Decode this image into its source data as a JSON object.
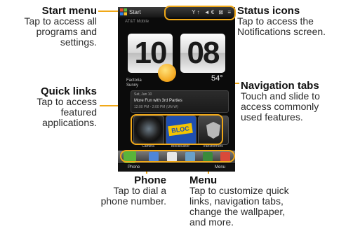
{
  "callouts": {
    "start_menu": {
      "title": "Start menu",
      "desc": [
        "Tap to access all",
        "programs and",
        "settings."
      ]
    },
    "quick_links": {
      "title": "Quick links",
      "desc": [
        "Tap to access",
        "featured",
        "applications."
      ]
    },
    "status_icons": {
      "title": "Status icons",
      "desc": [
        "Tap to access the",
        "Notifications screen."
      ]
    },
    "navigation_tabs": {
      "title": "Navigation tabs",
      "desc": [
        "Touch and slide to",
        "access commonly",
        "used features."
      ]
    },
    "phone": {
      "title": "Phone",
      "desc": [
        "Tap to dial a",
        "phone number."
      ]
    },
    "menu": {
      "title": "Menu",
      "desc": [
        "Tap to customize quick",
        "links, navigation tabs,",
        "change the wallpaper,",
        "and more."
      ]
    }
  },
  "screen": {
    "start_label": "Start",
    "status_icons_text": "Y↑ ◄€ ⊠ ≡",
    "carrier": "AT&T Mobile",
    "clock": {
      "hour": "10",
      "minute": "08"
    },
    "weather": {
      "location": "Factoria",
      "condition": "Sunny",
      "temperature": "54°"
    },
    "message": {
      "date": "Sat, Jan 10",
      "title": "More Fun with 3rd Parties",
      "time": "12:00 PM - 2:00 PM (UN-W)"
    },
    "quick_links": [
      {
        "label": "Camera"
      },
      {
        "label": "Blockbuster",
        "logo_text": "BLOC"
      },
      {
        "label": "Transformers"
      }
    ],
    "softkeys": {
      "left": "Phone",
      "right": "Menu"
    }
  },
  "colors": {
    "accent": "#f0a818",
    "screen_bg": "#0b0b0b"
  }
}
